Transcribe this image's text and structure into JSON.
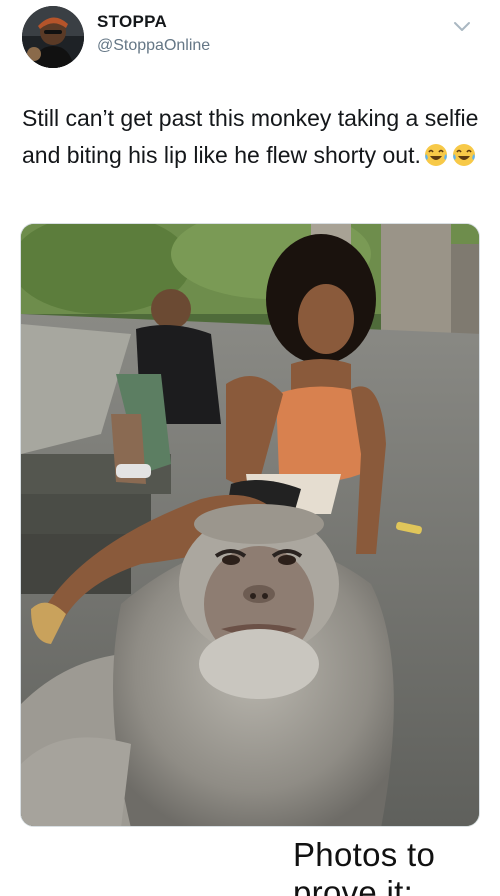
{
  "tweet": {
    "author_name": "STOPPA",
    "author_handle": "@StoppaOnline",
    "text": "Still can’t get past this monkey taking a selfie and biting his lip like he flew shorty out.",
    "emojis": [
      "face-with-tears-of-joy-icon",
      "face-with-tears-of-joy-icon"
    ],
    "menu_icon": "chevron-down-icon"
  },
  "caption": "Photos to prove it:",
  "colors": {
    "text": "#14171a",
    "handle": "#657786",
    "chevron": "#aab8c2"
  }
}
